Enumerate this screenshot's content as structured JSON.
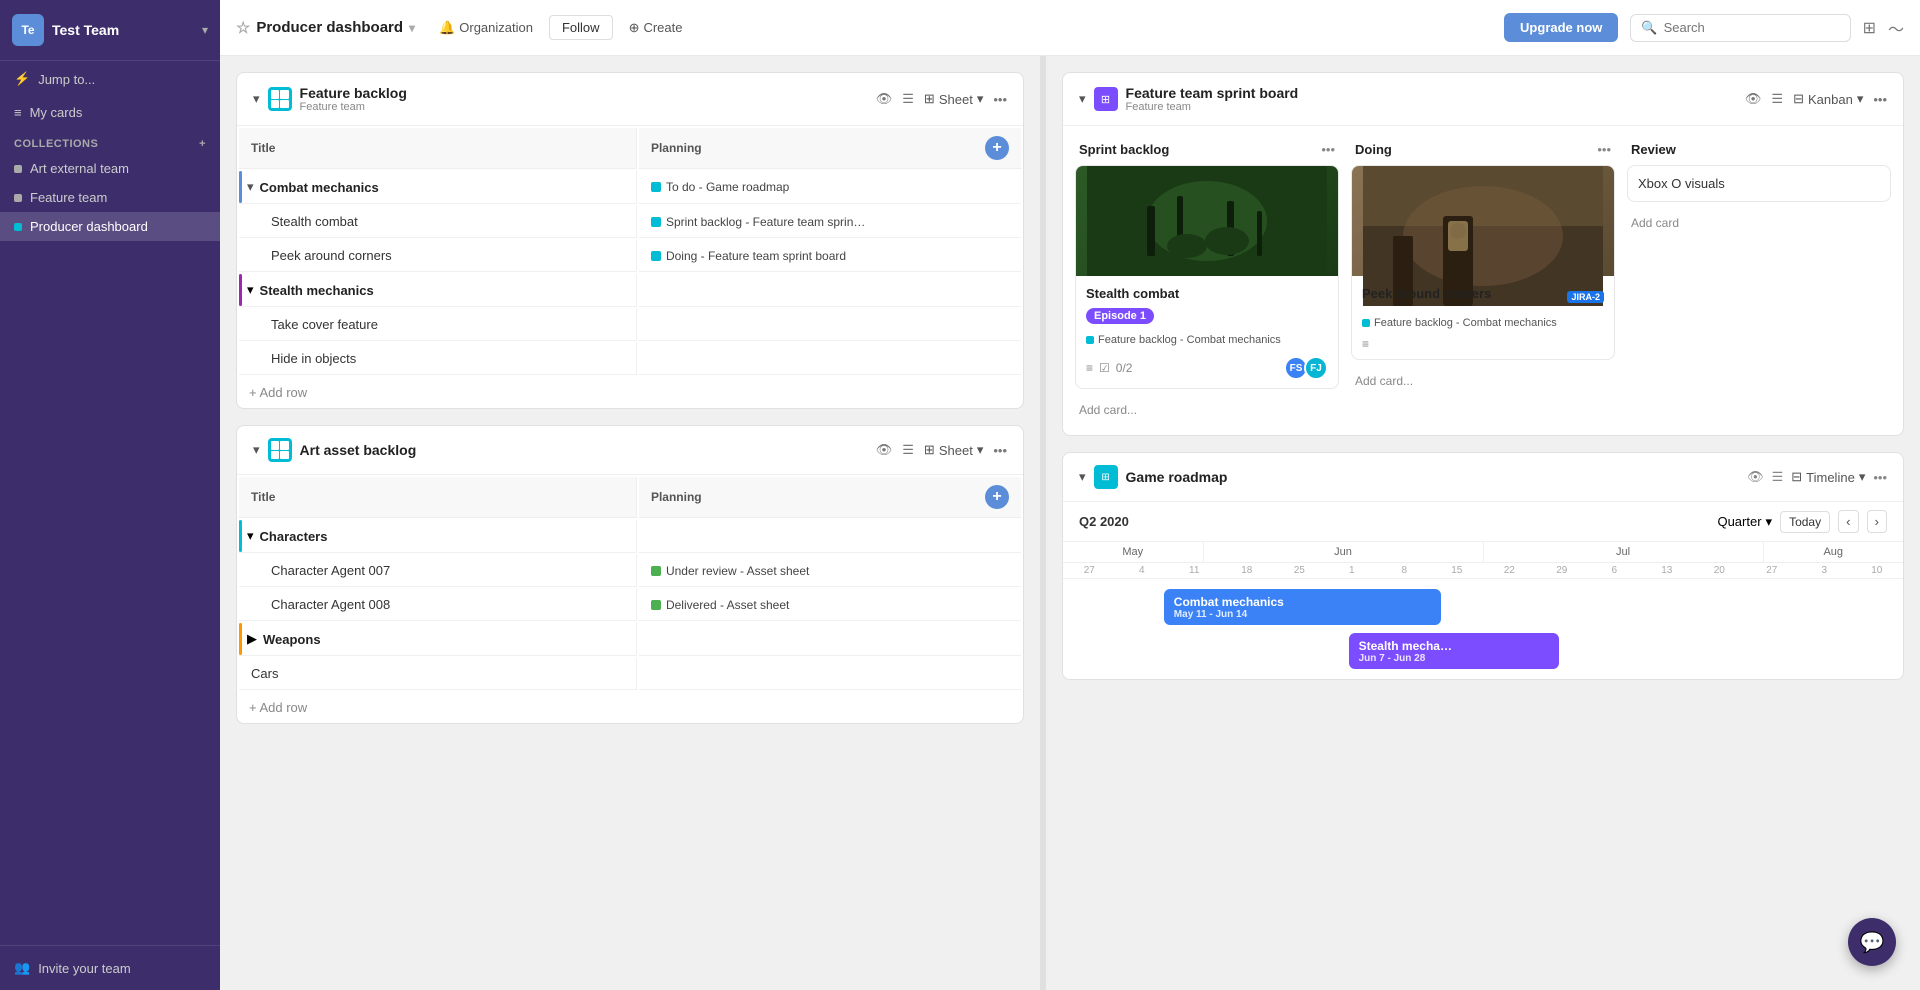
{
  "sidebar": {
    "team": {
      "avatar": "Te",
      "name": "Test Team",
      "subtitle": "••••••••"
    },
    "jump": "Jump to...",
    "mycards": "My cards",
    "collections_label": "Collections",
    "items": [
      {
        "id": "art-external-team",
        "label": "Art external team",
        "active": false
      },
      {
        "id": "feature-team",
        "label": "Feature team",
        "active": false
      },
      {
        "id": "producer-dashboard",
        "label": "Producer dashboard",
        "active": true
      }
    ],
    "footer": {
      "invite": "Invite your team"
    }
  },
  "topbar": {
    "title": "Producer dashboard",
    "org_label": "Organization",
    "follow_label": "Follow",
    "create_label": "Create",
    "upgrade_label": "Upgrade now",
    "search_placeholder": "Search"
  },
  "left_panel": {
    "board1": {
      "title": "Feature backlog",
      "subtitle": "Feature team",
      "view_label": "Sheet",
      "columns": [
        "Title",
        "Planning"
      ],
      "groups": [
        {
          "name": "Combat mechanics",
          "rows": [
            {
              "title": "Stealth combat",
              "status": "Sprint backlog - Feature team sprin…",
              "dot": "teal"
            },
            {
              "title": "Peek around corners",
              "status": "Doing - Feature team sprint board",
              "dot": "teal"
            }
          ]
        },
        {
          "name": "Stealth mechanics",
          "rows": [
            {
              "title": "Take cover feature",
              "status": "",
              "dot": ""
            },
            {
              "title": "Hide in objects",
              "status": "",
              "dot": ""
            }
          ]
        }
      ],
      "group1_status": "To do - Game roadmap",
      "add_row": "+ Add row"
    },
    "board2": {
      "title": "Art asset backlog",
      "subtitle": "",
      "view_label": "Sheet",
      "columns": [
        "Title",
        "Planning"
      ],
      "groups": [
        {
          "name": "Characters",
          "rows": [
            {
              "title": "Character Agent 007",
              "status": "Under review - Asset sheet",
              "dot": "green"
            },
            {
              "title": "Character Agent 008",
              "status": "Delivered - Asset sheet",
              "dot": "green"
            }
          ]
        },
        {
          "name": "Weapons",
          "rows": []
        },
        {
          "name": "Cars",
          "rows": []
        }
      ],
      "add_row": "+ Add row"
    }
  },
  "right_panel": {
    "kanban": {
      "title": "Feature team sprint board",
      "subtitle": "Feature team",
      "view_label": "Kanban",
      "columns": [
        {
          "name": "Sprint backlog",
          "cards": [
            {
              "img": "forest",
              "title": "Stealth combat",
              "tag": "Episode 1",
              "tag_color": "purple",
              "link": "Feature backlog - Combat mechanics",
              "checklist": "0/2",
              "avatars": [
                "FS",
                "FJ"
              ]
            }
          ],
          "add_card": "Add card..."
        },
        {
          "name": "Doing",
          "cards": [
            {
              "img": "battle",
              "title": "Peek around corners",
              "link": "Feature backlog - Combat mechanics",
              "jira": "JIRA-2"
            }
          ],
          "add_card": "Add card..."
        },
        {
          "name": "Review",
          "cards": [
            {
              "title": "Xbox O visuals",
              "placeholder": true
            }
          ],
          "add_card": "Add card"
        }
      ]
    },
    "roadmap": {
      "title": "Game roadmap",
      "subtitle": "",
      "view_label": "Timeline",
      "quarter": "Q2 2020",
      "today": "Today",
      "months": [
        "May",
        "May",
        "May",
        "Jun",
        "Jun",
        "Jun",
        "Jun",
        "Jun",
        "Jul",
        "Jul",
        "Jul",
        "Jul",
        "Aug"
      ],
      "dates": [
        "27",
        "4",
        "11",
        "18",
        "25",
        "1",
        "8",
        "15",
        "22",
        "29",
        "6",
        "13",
        "20",
        "27",
        "3",
        "10"
      ],
      "bars": [
        {
          "title": "Combat mechanics",
          "dates": "May 11 - Jun 14",
          "color": "blue",
          "left_pct": 10,
          "width_pct": 35
        },
        {
          "title": "Stealth mecha…",
          "dates": "Jun 7 - Jun 28",
          "color": "purple",
          "left_pct": 30,
          "width_pct": 25
        }
      ]
    }
  }
}
